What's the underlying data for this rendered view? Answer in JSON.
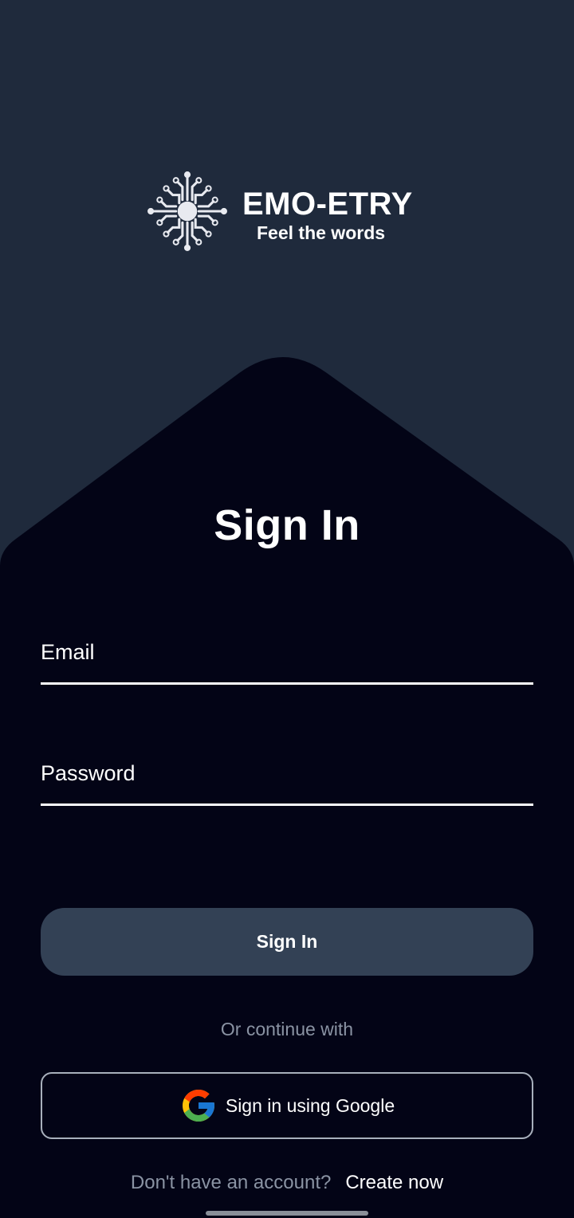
{
  "brand": {
    "name": "EMO-ETRY",
    "tagline": "Feel the words",
    "logo_icon": "circuit-hub-icon"
  },
  "signin": {
    "title": "Sign In",
    "email_placeholder": "Email",
    "password_placeholder": "Password",
    "submit_label": "Sign In"
  },
  "social": {
    "divider_text": "Or continue with",
    "google_label": "Sign in using Google",
    "google_icon": "google-g-icon"
  },
  "footer": {
    "prompt": "Don't have an account?",
    "link_label": "Create now"
  },
  "colors": {
    "top_background": "#1f2a3c",
    "panel_background": "#030416",
    "button_background": "#334155",
    "muted_text": "#8a93a3"
  }
}
